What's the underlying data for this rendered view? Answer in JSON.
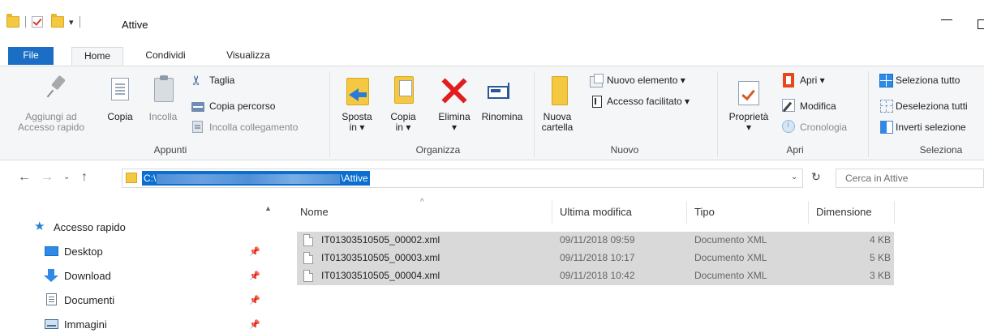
{
  "window": {
    "title": "Attive"
  },
  "tabs": {
    "file": "File",
    "home": "Home",
    "share": "Condividi",
    "view": "Visualizza"
  },
  "ribbon": {
    "appunti": {
      "label": "Appunti",
      "pin_line1": "Aggiungi ad",
      "pin_line2": "Accesso rapido",
      "copy": "Copia",
      "paste": "Incolla",
      "cut": "Taglia",
      "copy_path": "Copia percorso",
      "paste_link": "Incolla collegamento"
    },
    "organizza": {
      "label": "Organizza",
      "move_line1": "Sposta",
      "move_line2": "in ▾",
      "copyto_line1": "Copia",
      "copyto_line2": "in ▾",
      "delete": "Elimina",
      "delete_arrow": "▾",
      "rename": "Rinomina"
    },
    "nuovo": {
      "label": "Nuovo",
      "newfolder_line1": "Nuova",
      "newfolder_line2": "cartella",
      "new_item": "Nuovo elemento ▾",
      "easy_access": "Accesso facilitato ▾"
    },
    "apri": {
      "label": "Apri",
      "properties": "Proprietà",
      "properties_arrow": "▾",
      "open": "Apri ▾",
      "edit": "Modifica",
      "history": "Cronologia"
    },
    "seleziona": {
      "label": "Seleziona",
      "select_all": "Seleziona tutto",
      "select_none": "Deseleziona tutti",
      "invert": "Inverti selezione"
    }
  },
  "address": {
    "prefix": "C:\\",
    "suffix": "\\Attive",
    "search_placeholder": "Cerca in Attive"
  },
  "navpane": {
    "items": [
      {
        "label": "Accesso rapido",
        "icon": "star-icon",
        "pinned": false
      },
      {
        "label": "Desktop",
        "icon": "desktop-icon",
        "pinned": true
      },
      {
        "label": "Download",
        "icon": "download-icon",
        "pinned": true
      },
      {
        "label": "Documenti",
        "icon": "documents-icon",
        "pinned": true
      },
      {
        "label": "Immagini",
        "icon": "pictures-icon",
        "pinned": true
      }
    ]
  },
  "files": {
    "columns": {
      "name": "Nome",
      "modified": "Ultima modifica",
      "type": "Tipo",
      "size": "Dimensione"
    },
    "rows": [
      {
        "name": "IT01303510505_00002.xml",
        "modified": "09/11/2018 09:59",
        "type": "Documento XML",
        "size": "4 KB"
      },
      {
        "name": "IT01303510505_00003.xml",
        "modified": "09/11/2018 10:17",
        "type": "Documento XML",
        "size": "5 KB"
      },
      {
        "name": "IT01303510505_00004.xml",
        "modified": "09/11/2018 10:42",
        "type": "Documento XML",
        "size": "3 KB"
      }
    ]
  },
  "colors": {
    "accent": "#1a6fc4",
    "selection": "#0a6fd1",
    "row_selected": "#d9d9d9"
  }
}
